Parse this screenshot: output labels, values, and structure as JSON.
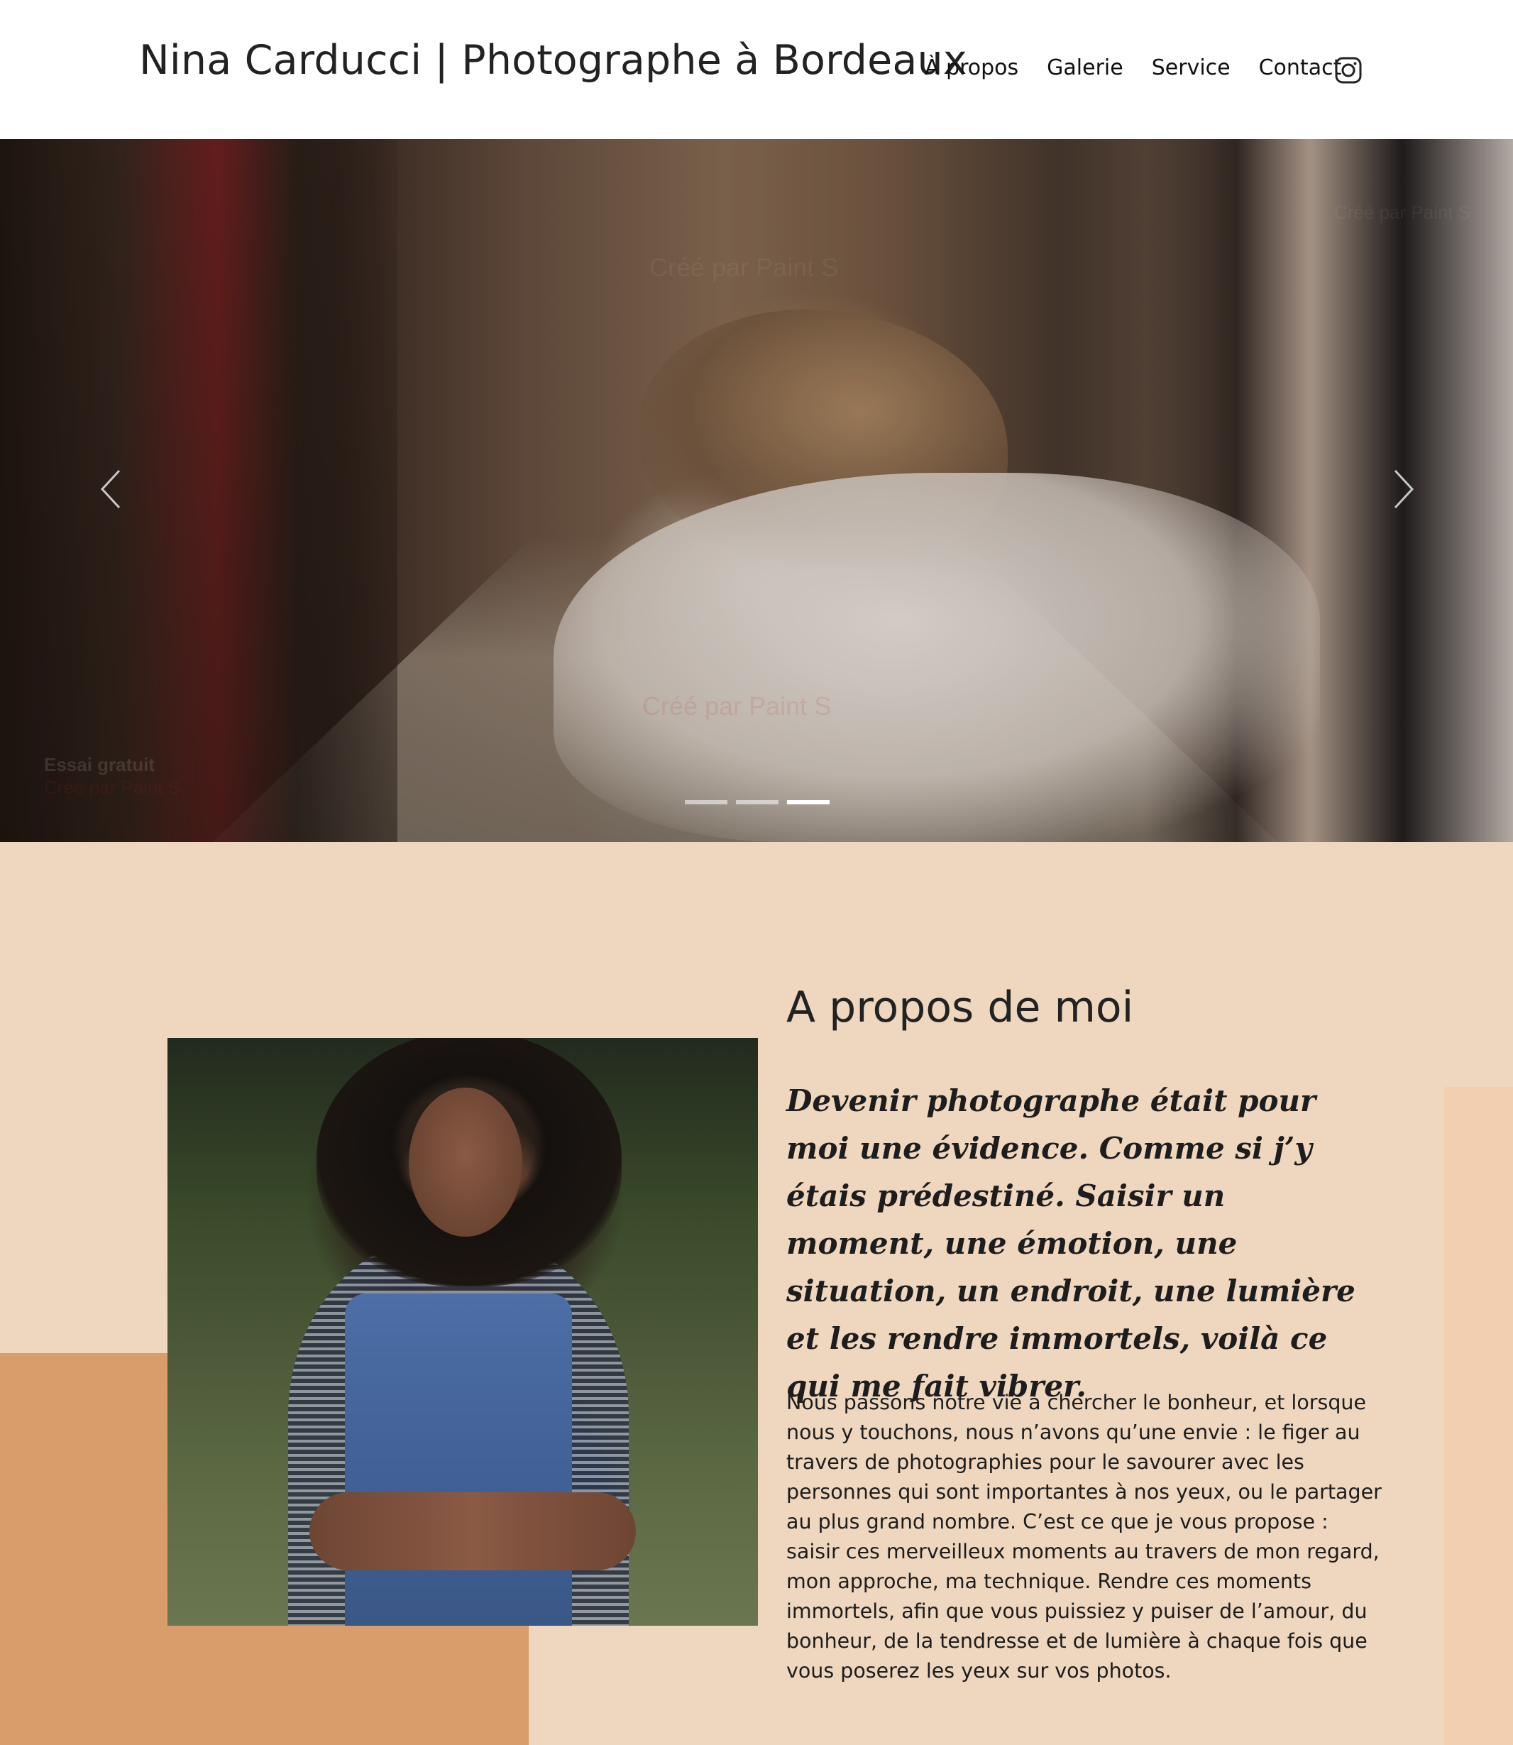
{
  "header": {
    "site_title": "Nina Carducci | Photographe à Bordeaux",
    "nav": [
      "À propos",
      "Galerie",
      "Service",
      "Contact"
    ],
    "instagram_icon": "instagram-icon"
  },
  "hero": {
    "watermark_texts": [
      "Créé par Paint S",
      "Créé par Paint S",
      "Créé par Paint S"
    ],
    "trial_text": "Essai gratuit",
    "trial_sub": "Créé par Paint S",
    "slides_count": 3,
    "active_slide": 3,
    "prev_icon": "chevron-left-icon",
    "next_icon": "chevron-right-icon"
  },
  "about": {
    "title": "A propos de moi",
    "quote": "Devenir photographe était pour moi une évidence. Comme si j’y étais prédestiné. Saisir un moment, une émotion, une situation, un endroit, une lumière et les rendre immortels, voilà ce qui me fait vibrer.",
    "text": "Nous passons notre vie à chercher le bonheur, et lorsque nous y touchons, nous n’avons qu’une envie : le figer au travers de photographies pour le savourer avec les personnes qui sont importantes à nos yeux, ou le partager au plus grand nombre. C’est ce que je vous propose : saisir ces merveilleux moments au travers de mon regard, mon approche, ma technique. Rendre ces moments immortels, afin que vous puissiez y puiser de l’amour, du bonheur, de la tendresse et de lumière à chaque fois que vous poserez les yeux sur vos photos."
  },
  "colors": {
    "about_bg": "#eed6bf",
    "accent_orange": "#d99c6b",
    "accent_peach": "#f2cfb0"
  }
}
